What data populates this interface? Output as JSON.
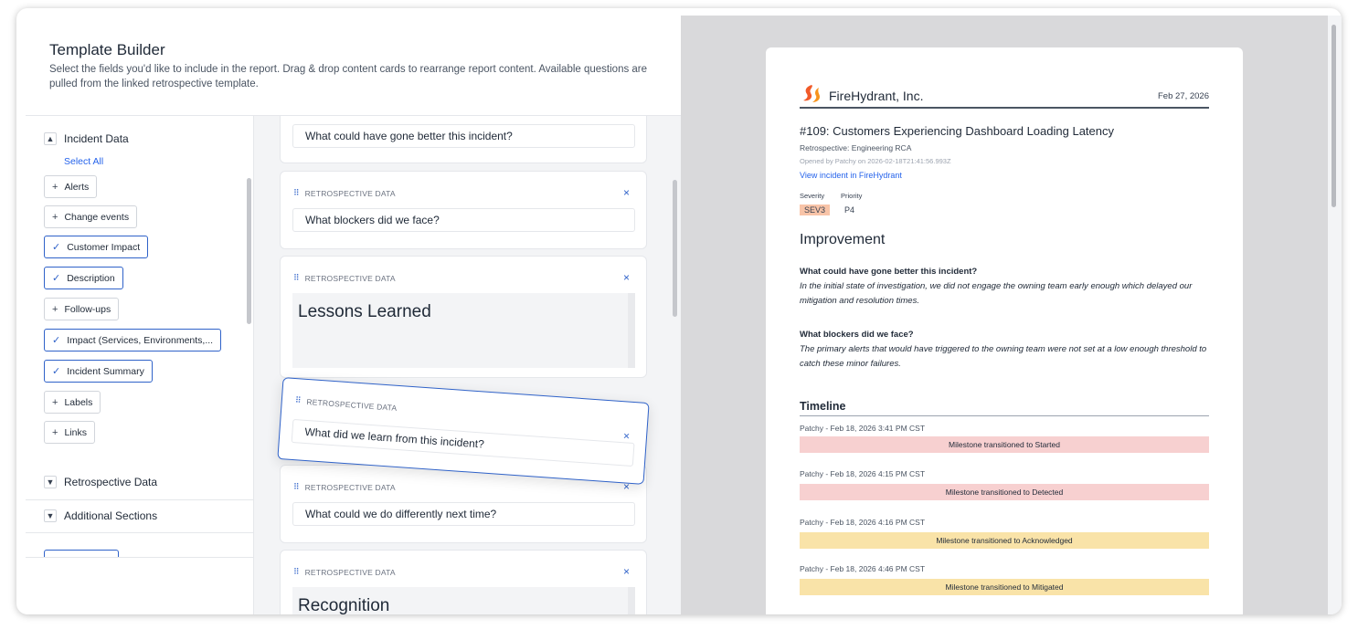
{
  "builder": {
    "title": "Template Builder",
    "description": "Select the fields you'd like to include in the report. Drag & drop content cards to rearrange report content. Available questions are pulled from the linked retrospective template."
  },
  "fields": {
    "sections": [
      {
        "label": "Incident Data",
        "expanded": true
      },
      {
        "label": "Retrospective Data",
        "expanded": false
      },
      {
        "label": "Additional Sections",
        "expanded": false
      }
    ],
    "select_all": "Select All",
    "items": [
      {
        "label": "Alerts",
        "selected": false
      },
      {
        "label": "Change events",
        "selected": false
      },
      {
        "label": "Customer Impact",
        "selected": true
      },
      {
        "label": "Description",
        "selected": true
      },
      {
        "label": "Follow-ups",
        "selected": false
      },
      {
        "label": "Impact (Services, Environments,...",
        "selected": true
      },
      {
        "label": "Incident Summary",
        "selected": true
      },
      {
        "label": "Labels",
        "selected": false
      },
      {
        "label": "Links",
        "selected": false
      }
    ],
    "mark_plus": "+",
    "mark_check": "✓"
  },
  "cards": {
    "category_label": "RETROSPECTIVE DATA",
    "close_glyph": "×",
    "grip_glyph": "⠿",
    "items": [
      {
        "question": "What could have gone better this incident?"
      },
      {
        "question": "What blockers did we face?"
      },
      {
        "question": "Lessons Learned"
      },
      {
        "question": "What did we learn from this incident?"
      },
      {
        "question": "What could we do differently next time?"
      },
      {
        "question": "Recognition"
      }
    ]
  },
  "preview": {
    "company": "FireHydrant, Inc.",
    "date": "Feb 27, 2026",
    "incident_title": "#109: Customers Experiencing Dashboard Loading Latency",
    "retrospective": "Retrospective: Engineering RCA",
    "opened_by": "Opened by Patchy on 2026-02-18T21:41:56.993Z",
    "view_link": "View incident in FireHydrant",
    "severity_label": "Severity",
    "priority_label": "Priority",
    "severity": "SEV3",
    "priority": "P4",
    "section_title": "Improvement",
    "qa": [
      {
        "question": "What could have gone better this incident?",
        "answer": "In the initial state of investigation, we did not engage the owning team early enough which delayed our mitigation and resolution times."
      },
      {
        "question": "What blockers did we face?",
        "answer": "The primary alerts that would have triggered to the owning team were not set at a low enough threshold to catch these minor failures."
      }
    ],
    "timeline_title": "Timeline",
    "timeline": [
      {
        "meta": "Patchy - Feb 18, 2026 3:41 PM CST",
        "event": "Milestone transitioned to Started",
        "color": "#f7d0d0"
      },
      {
        "meta": "Patchy - Feb 18, 2026 4:15 PM CST",
        "event": "Milestone transitioned to Detected",
        "color": "#f7d0d0"
      },
      {
        "meta": "Patchy - Feb 18, 2026 4:16 PM CST",
        "event": "Milestone transitioned to Acknowledged",
        "color": "#f9e3a8"
      },
      {
        "meta": "Patchy - Feb 18, 2026 4:46 PM CST",
        "event": "Milestone transitioned to Mitigated",
        "color": "#f9e3a8"
      }
    ]
  },
  "colors": {
    "accent": "#2f62c9",
    "brand": "#f15a29",
    "severity_bg": "#f8c4a8"
  }
}
